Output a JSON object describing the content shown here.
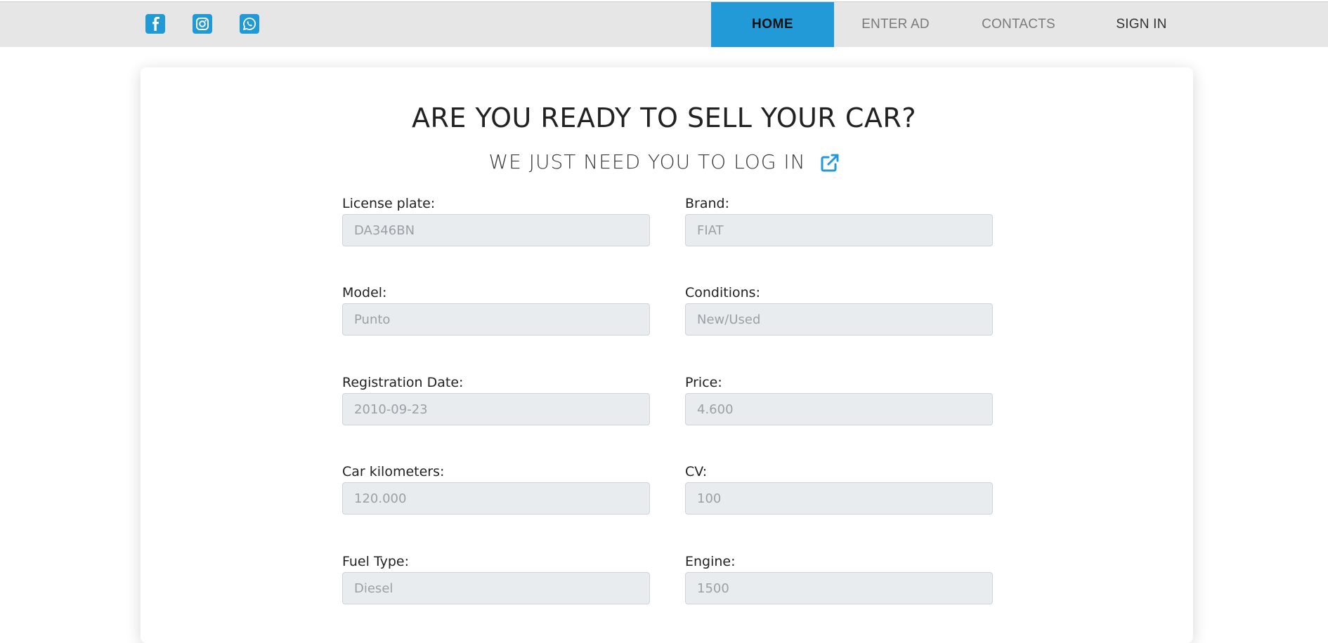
{
  "header": {
    "social": [
      {
        "icon": "facebook-icon"
      },
      {
        "icon": "instagram-icon"
      },
      {
        "icon": "whatsapp-icon"
      }
    ],
    "nav": [
      {
        "label": "HOME",
        "active": true
      },
      {
        "label": "ENTER AD"
      },
      {
        "label": "CONTACTS"
      },
      {
        "label": "SIGN IN"
      }
    ],
    "accent": "#219ad7"
  },
  "main": {
    "title": "ARE YOU READY TO SELL YOUR CAR?",
    "subtitle": "WE JUST NEED YOU TO LOG IN",
    "subtitle_icon": "external-link-icon"
  },
  "form": {
    "fields": [
      {
        "label": "License plate:",
        "placeholder": "DA346BN"
      },
      {
        "label": "Brand:",
        "placeholder": "FIAT"
      },
      {
        "label": "Model:",
        "placeholder": "Punto"
      },
      {
        "label": "Conditions:",
        "placeholder": "New/Used"
      },
      {
        "label": "Registration Date:",
        "placeholder": "2010-09-23"
      },
      {
        "label": "Price:",
        "placeholder": "4.600"
      },
      {
        "label": "Car kilometers:",
        "placeholder": "120.000"
      },
      {
        "label": "CV:",
        "placeholder": "100"
      },
      {
        "label": "Fuel Type:",
        "placeholder": "Diesel"
      },
      {
        "label": "Engine:",
        "placeholder": "1500"
      }
    ]
  }
}
